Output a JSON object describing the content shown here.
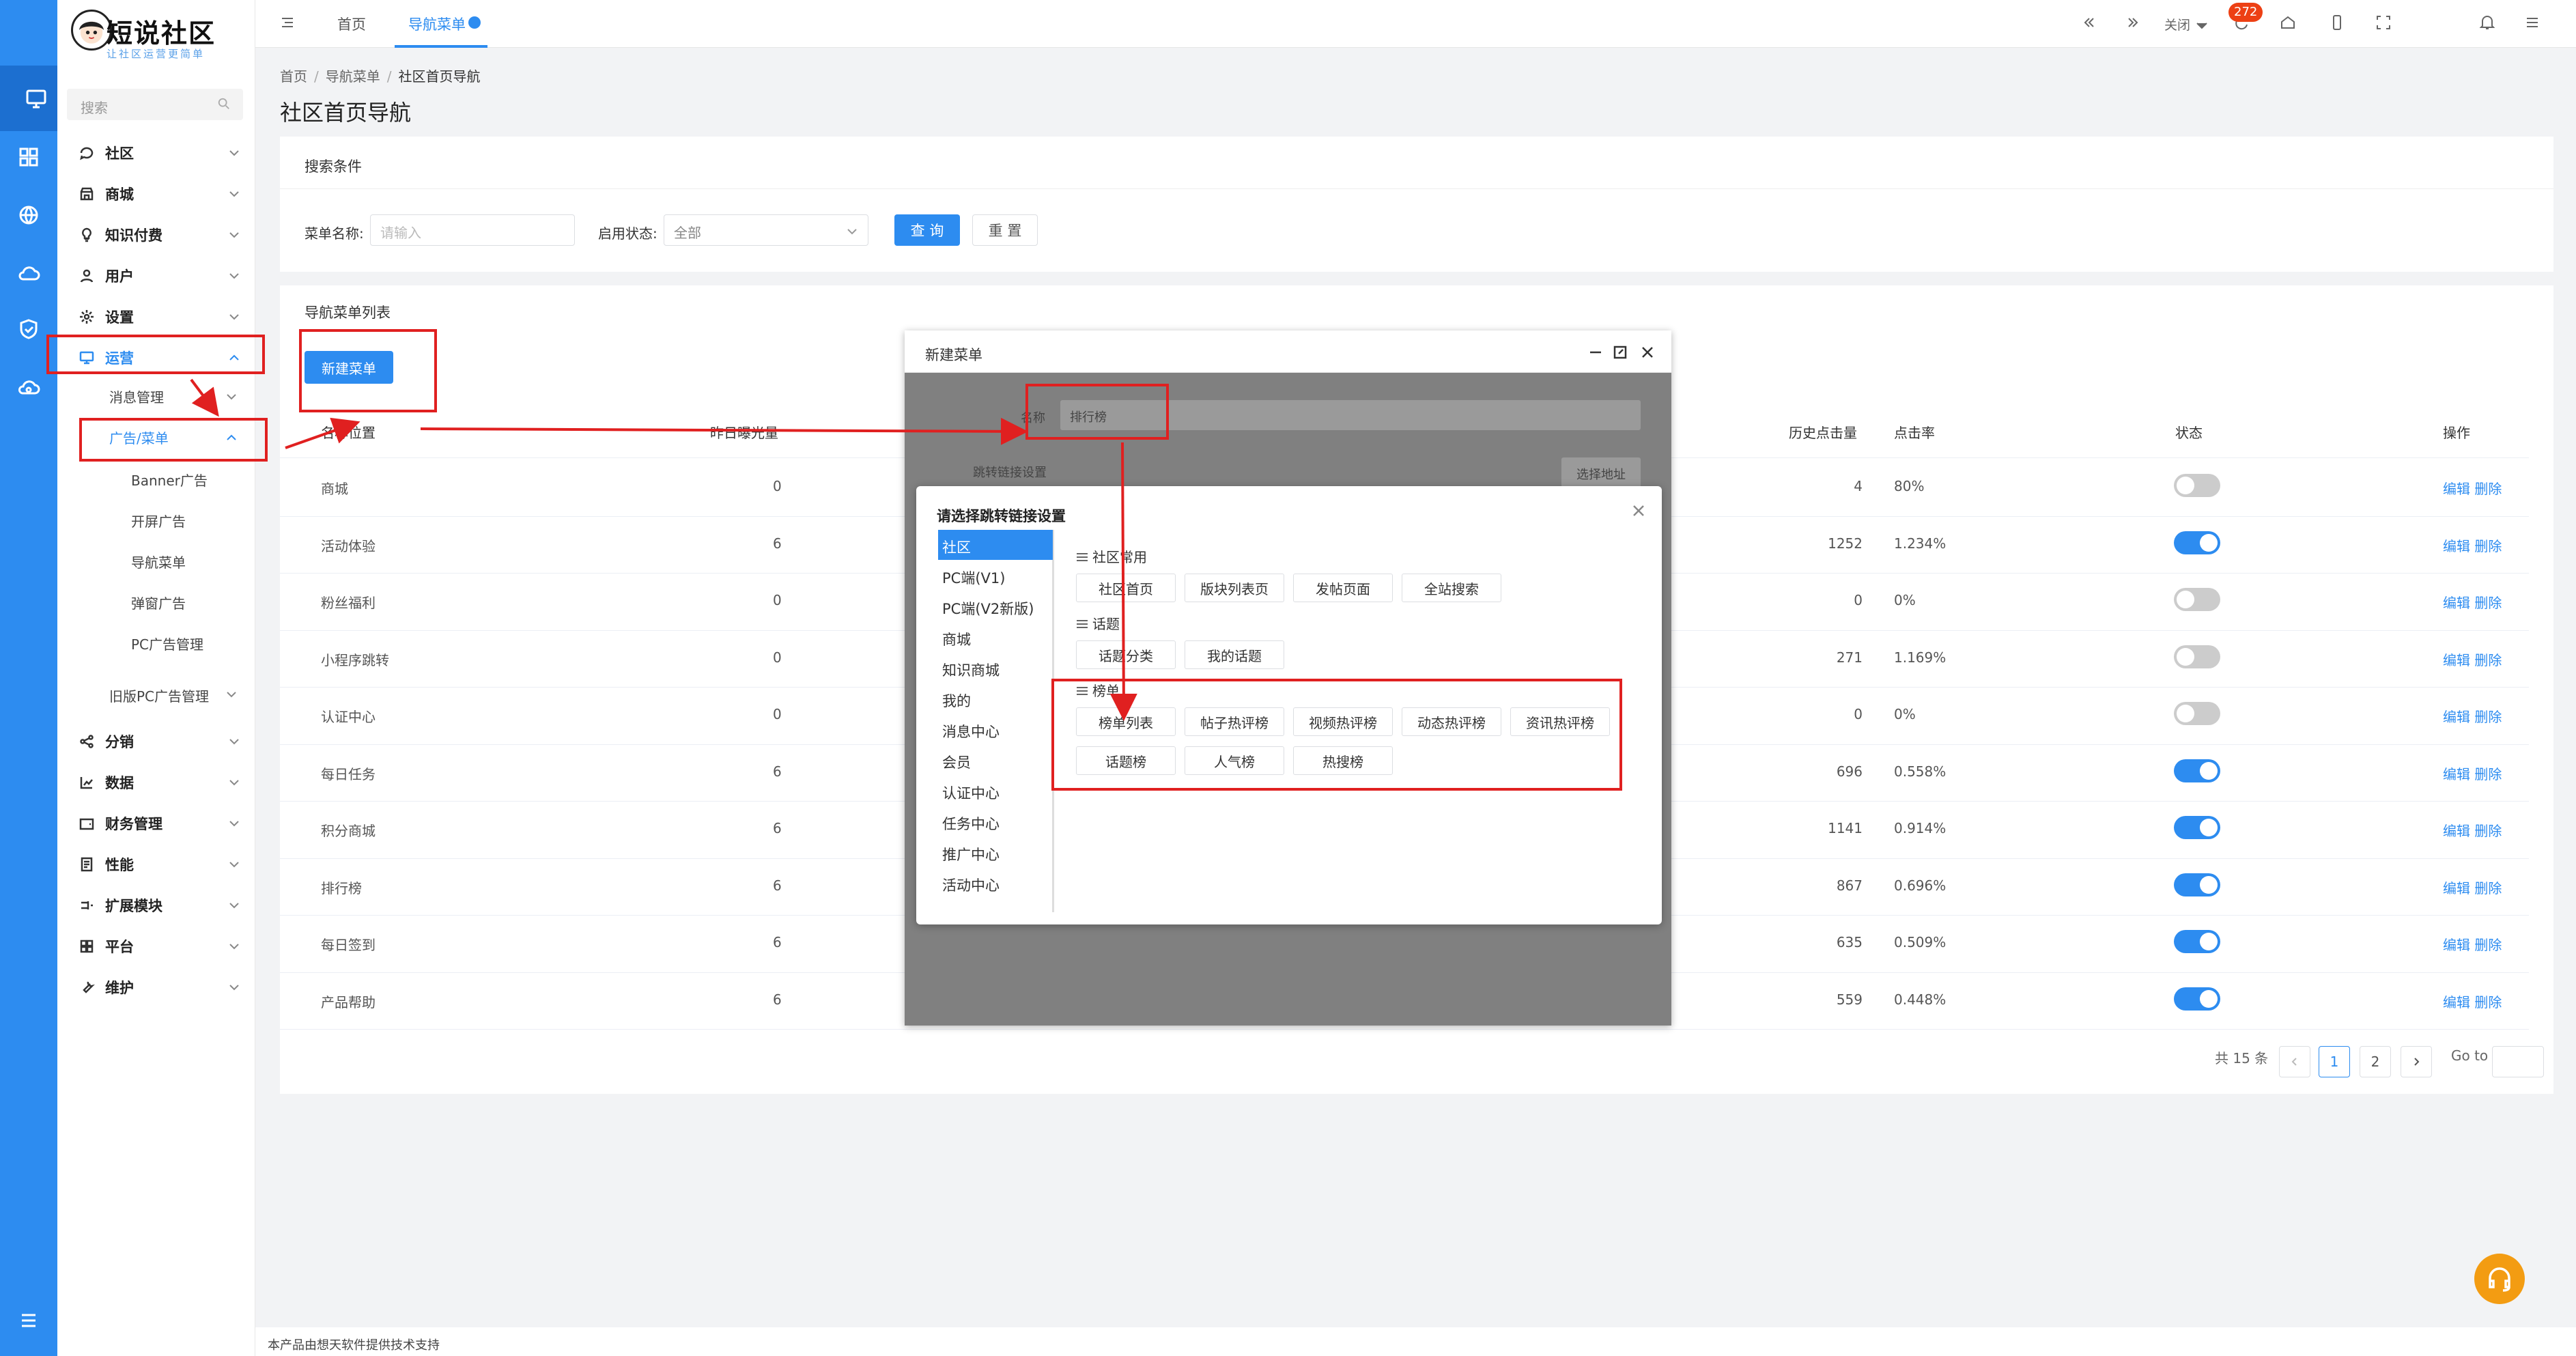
{
  "app": {
    "logo_title": "短说社区",
    "logo_subtitle": "让社区运营更简单",
    "search_placeholder": "搜索"
  },
  "sidebar": {
    "menu": [
      {
        "label": "社区",
        "icon": "chat-icon"
      },
      {
        "label": "商城",
        "icon": "store-icon"
      },
      {
        "label": "知识付费",
        "icon": "bulb-icon"
      },
      {
        "label": "用户",
        "icon": "user-icon"
      },
      {
        "label": "设置",
        "icon": "gear-icon"
      },
      {
        "label": "运营",
        "icon": "monitor-icon"
      },
      {
        "label": "分销",
        "icon": "share-icon"
      },
      {
        "label": "数据",
        "icon": "chart-icon"
      },
      {
        "label": "财务管理",
        "icon": "wallet-icon"
      },
      {
        "label": "性能",
        "icon": "doc-icon"
      },
      {
        "label": "扩展模块",
        "icon": "extend-icon"
      },
      {
        "label": "平台",
        "icon": "grid-icon"
      },
      {
        "label": "维护",
        "icon": "wrench-icon"
      }
    ],
    "sub": {
      "msg": "消息管理",
      "ads": "广告/菜单",
      "ad_items": [
        "Banner广告",
        "开屏广告",
        "导航菜单",
        "弹窗广告",
        "PC广告管理"
      ],
      "old_pc": "旧版PC广告管理"
    }
  },
  "topbar": {
    "tabs": [
      "首页",
      "导航菜单"
    ],
    "close_label": "关闭",
    "badge": "272"
  },
  "breadcrumb": [
    "首页",
    "导航菜单",
    "社区首页导航"
  ],
  "page_title": "社区首页导航",
  "search": {
    "title": "搜索条件",
    "name_label": "菜单名称:",
    "name_placeholder": "请输入",
    "status_label": "启用状态:",
    "status_value": "全部",
    "query": "查 询",
    "reset": "重 置"
  },
  "list": {
    "title": "导航菜单列表",
    "new_button": "新建菜单",
    "headers": {
      "name": "名称位置",
      "yesterday": "昨日曝光量",
      "total": "历史点击量",
      "rate": "点击率",
      "status": "状态",
      "ops": "操作"
    },
    "rows": [
      {
        "name": "商城",
        "yesterday": "0",
        "total": "4",
        "rate": "80%",
        "on": false
      },
      {
        "name": "活动体验",
        "yesterday": "6",
        "total": "1252",
        "rate": "1.234%",
        "on": true
      },
      {
        "name": "粉丝福利",
        "yesterday": "0",
        "total": "0",
        "rate": "0%",
        "on": false
      },
      {
        "name": "小程序跳转",
        "yesterday": "0",
        "total": "271",
        "rate": "1.169%",
        "on": false
      },
      {
        "name": "认证中心",
        "yesterday": "0",
        "total": "0",
        "rate": "0%",
        "on": false
      },
      {
        "name": "每日任务",
        "yesterday": "6",
        "total": "696",
        "rate": "0.558%",
        "on": true
      },
      {
        "name": "积分商城",
        "yesterday": "6",
        "total": "1141",
        "rate": "0.914%",
        "on": true
      },
      {
        "name": "排行榜",
        "yesterday": "6",
        "total": "867",
        "rate": "0.696%",
        "on": true
      },
      {
        "name": "每日签到",
        "yesterday": "6",
        "total": "635",
        "rate": "0.509%",
        "on": true
      },
      {
        "name": "产品帮助",
        "yesterday": "6",
        "total": "559",
        "rate": "0.448%",
        "on": true
      }
    ],
    "edit": "编辑",
    "delete": "删除"
  },
  "pager": {
    "total": "共 15 条",
    "pages": [
      "1",
      "2"
    ],
    "goto": "Go to"
  },
  "footer": "本产品由想天软件提供技术支持",
  "dialog_new": {
    "title": "新建菜单",
    "name_label": "名称",
    "name_value": "排行榜",
    "link_label": "跳转链接设置",
    "pick_label": "选择地址"
  },
  "dialog_link": {
    "title": "请选择跳转链接设置",
    "categories": [
      "社区",
      "PC端(V1)",
      "PC端(V2新版)",
      "商城",
      "知识商城",
      "我的",
      "消息中心",
      "会员",
      "认证中心",
      "任务中心",
      "推广中心",
      "活动中心"
    ],
    "groups": [
      {
        "title": "社区常用",
        "options": [
          "社区首页",
          "版块列表页",
          "发帖页面",
          "全站搜索"
        ]
      },
      {
        "title": "话题",
        "options": [
          "话题分类",
          "我的话题"
        ]
      },
      {
        "title": "榜单",
        "options": [
          "榜单列表",
          "帖子热评榜",
          "视频热评榜",
          "动态热评榜",
          "资讯热评榜",
          "话题榜",
          "人气榜",
          "热搜榜"
        ]
      }
    ]
  },
  "colors": {
    "primary": "#2d8cf0",
    "annotation": "#e02020",
    "badge": "#ed4014",
    "help": "#f39c12"
  }
}
